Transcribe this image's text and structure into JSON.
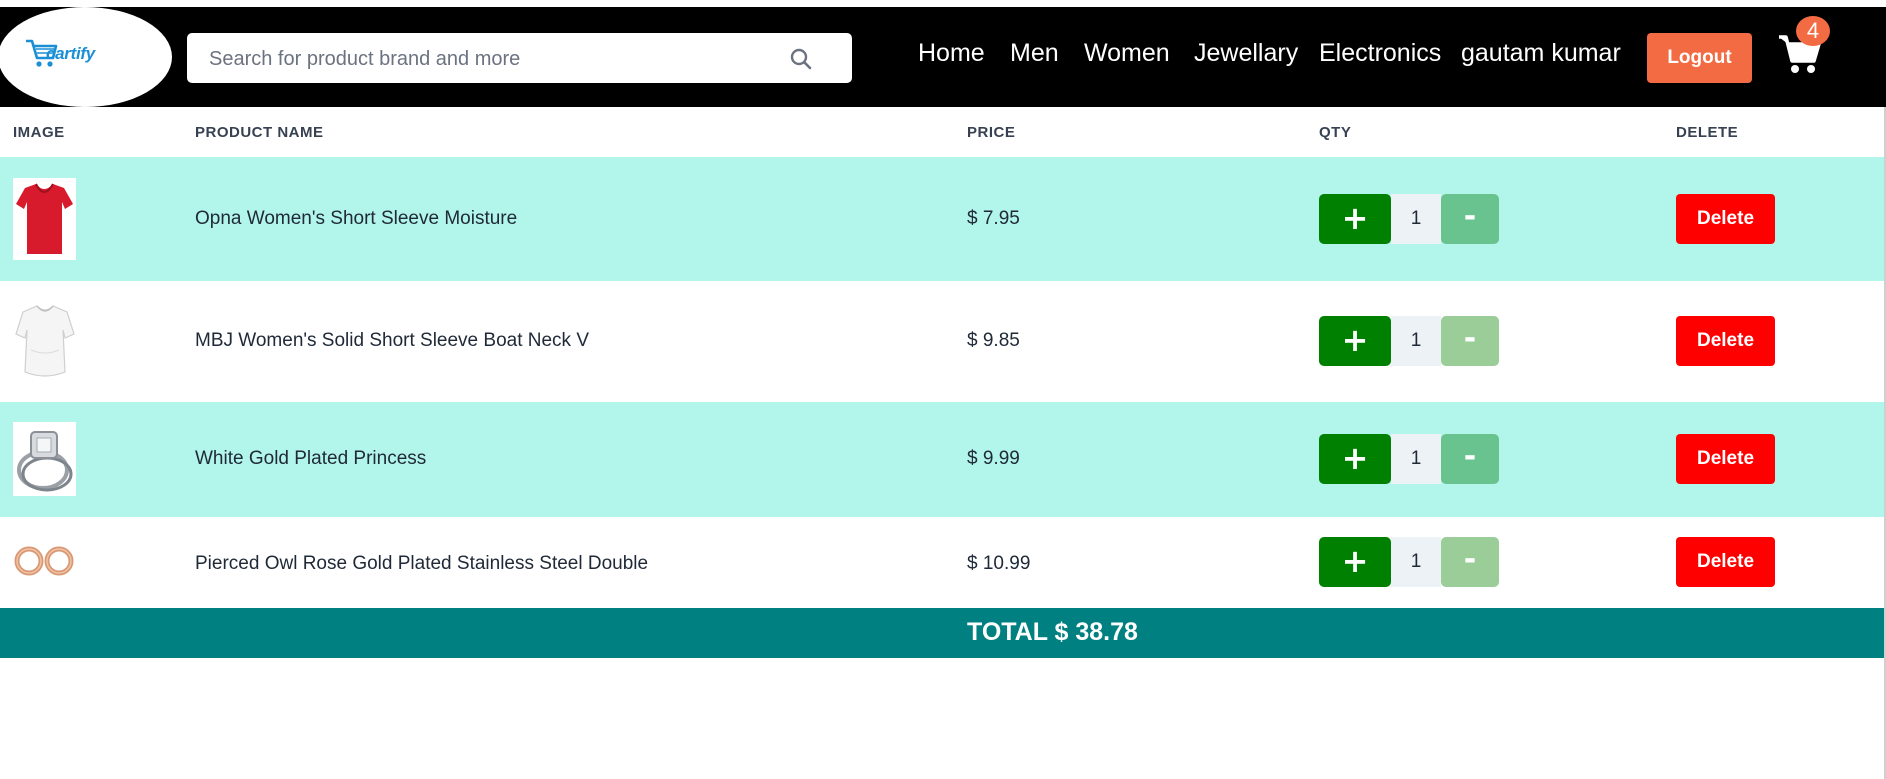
{
  "header": {
    "logo_text": "cartify",
    "search_placeholder": "Search for product brand and more",
    "nav": [
      "Home",
      "Men",
      "Women",
      "Jewellary",
      "Electronics",
      "gautam kumar"
    ],
    "logout_label": "Logout",
    "cart_count": "4"
  },
  "table": {
    "headers": [
      "IMAGE",
      "PRODUCT NAME",
      "PRICE",
      "QTY",
      "DELETE"
    ],
    "plus_label": "+",
    "minus_label": "-",
    "delete_label": "Delete",
    "rows": [
      {
        "image": "red-tshirt",
        "name": "Opna Women's Short Sleeve Moisture",
        "price": "$ 7.95",
        "qty": "1"
      },
      {
        "image": "white-top",
        "name": "MBJ Women's Solid Short Sleeve Boat Neck V",
        "price": "$ 9.85",
        "qty": "1"
      },
      {
        "image": "diamond-ring",
        "name": "White Gold Plated Princess",
        "price": "$ 9.99",
        "qty": "1"
      },
      {
        "image": "rose-gold-earrings",
        "name": "Pierced Owl Rose Gold Plated Stainless Steel Double",
        "price": "$ 10.99",
        "qty": "1"
      }
    ]
  },
  "total_label": "TOTAL $ 38.78",
  "colors": {
    "navbar_bg": "#000000",
    "accent_orange": "#f26b43",
    "row_highlight": "#b2f5ea",
    "plus_green": "#008000",
    "minus_green_light": "#68c38e",
    "minus_green_pale": "#9acd98",
    "delete_red": "#ff0000",
    "total_bar": "#008080"
  }
}
